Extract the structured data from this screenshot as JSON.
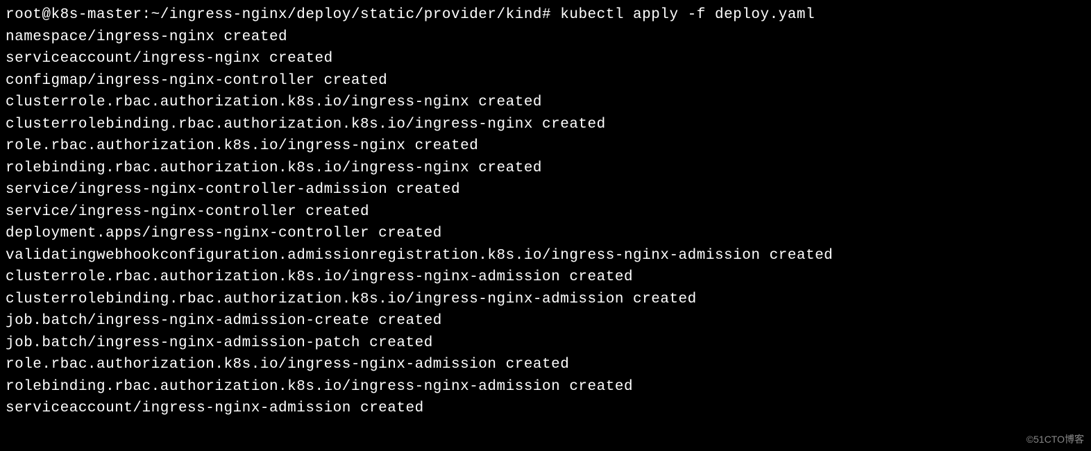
{
  "terminal": {
    "prompt": "root@k8s-master:~/ingress-nginx/deploy/static/provider/kind# ",
    "command": "kubectl apply -f deploy.yaml",
    "output_lines": [
      "namespace/ingress-nginx created",
      "serviceaccount/ingress-nginx created",
      "configmap/ingress-nginx-controller created",
      "clusterrole.rbac.authorization.k8s.io/ingress-nginx created",
      "clusterrolebinding.rbac.authorization.k8s.io/ingress-nginx created",
      "role.rbac.authorization.k8s.io/ingress-nginx created",
      "rolebinding.rbac.authorization.k8s.io/ingress-nginx created",
      "service/ingress-nginx-controller-admission created",
      "service/ingress-nginx-controller created",
      "deployment.apps/ingress-nginx-controller created",
      "validatingwebhookconfiguration.admissionregistration.k8s.io/ingress-nginx-admission created",
      "clusterrole.rbac.authorization.k8s.io/ingress-nginx-admission created",
      "clusterrolebinding.rbac.authorization.k8s.io/ingress-nginx-admission created",
      "job.batch/ingress-nginx-admission-create created",
      "job.batch/ingress-nginx-admission-patch created",
      "role.rbac.authorization.k8s.io/ingress-nginx-admission created",
      "rolebinding.rbac.authorization.k8s.io/ingress-nginx-admission created",
      "serviceaccount/ingress-nginx-admission created"
    ]
  },
  "watermark": "©51CTO博客"
}
